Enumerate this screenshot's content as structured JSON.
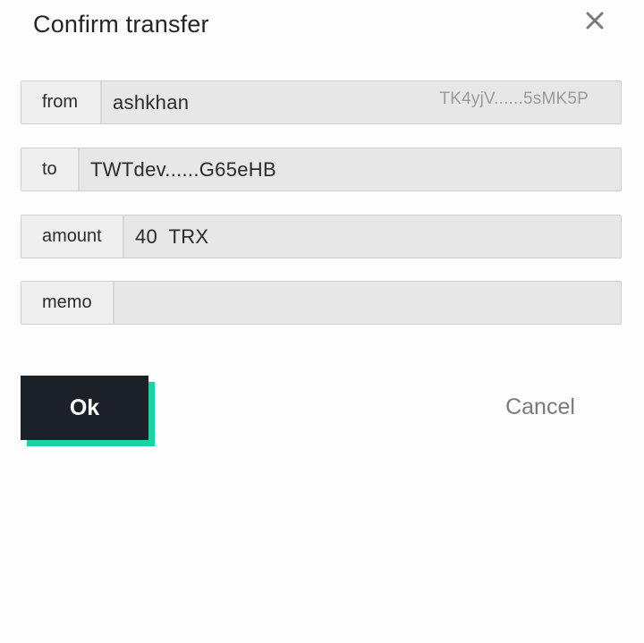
{
  "dialog": {
    "title": "Confirm transfer",
    "close_icon": "close-icon"
  },
  "fields": {
    "from": {
      "label": "from",
      "value": "ashkhan",
      "address": "TK4yjV......5sMK5P"
    },
    "to": {
      "label": "to",
      "value": "TWTdev......G65eHB"
    },
    "amount": {
      "label": "amount",
      "value": "40  TRX"
    },
    "memo": {
      "label": "memo",
      "value": ""
    }
  },
  "actions": {
    "ok_label": "Ok",
    "cancel_label": "Cancel"
  },
  "colors": {
    "accent": "#17d3a6",
    "button_dark": "#1b2127",
    "field_bg": "#e7e7e7"
  }
}
